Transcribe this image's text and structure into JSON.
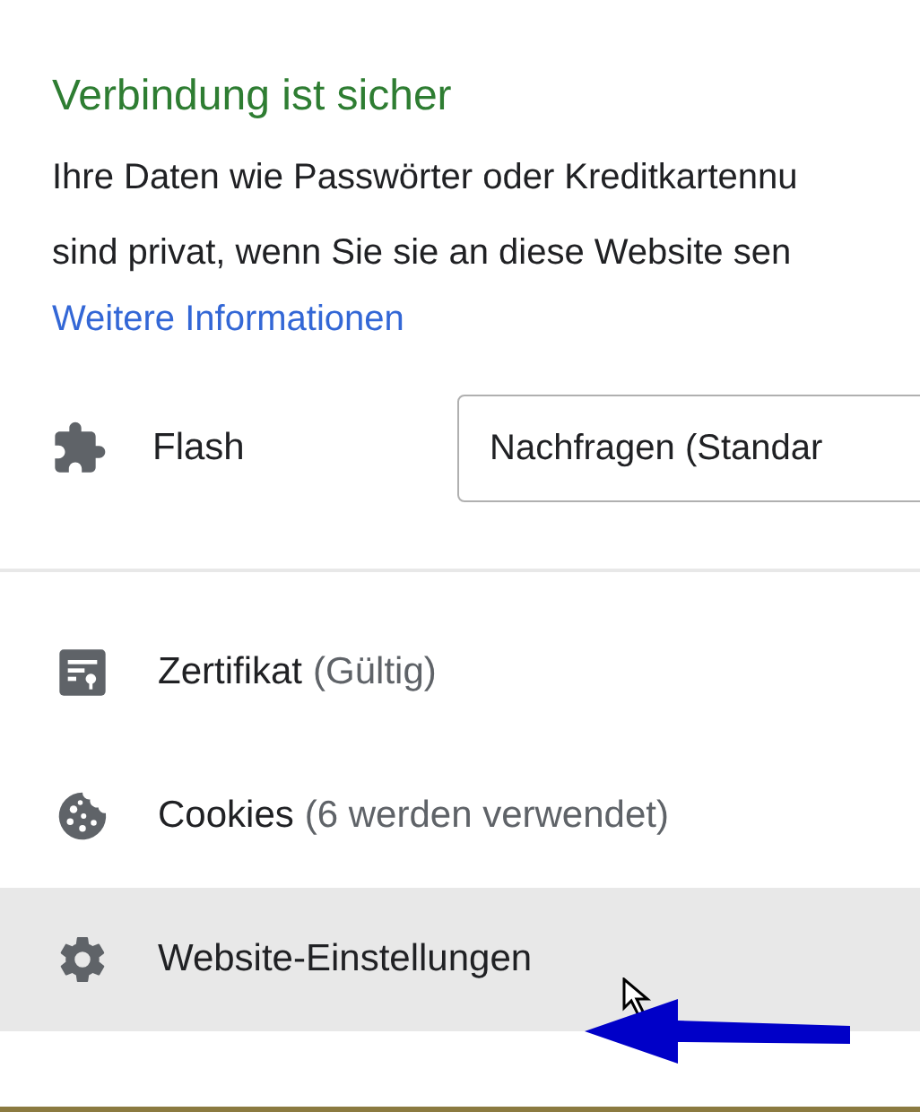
{
  "title": "Verbindung ist sicher",
  "description_lines": [
    "Ihre Daten wie Passwörter oder Kreditkartennu",
    "sind privat, wenn Sie sie an diese Website sen"
  ],
  "more_info_link": "Weitere Informationen",
  "permission": {
    "label": "Flash",
    "value": "Nachfragen (Standar"
  },
  "items": [
    {
      "kind": "certificate",
      "label": "Zertifikat",
      "detail": "(Gültig)",
      "highlighted": false
    },
    {
      "kind": "cookies",
      "label": "Cookies",
      "detail": "(6 werden verwendet)",
      "highlighted": false
    },
    {
      "kind": "settings",
      "label": "Website-Einstellungen",
      "highlighted": true
    }
  ]
}
